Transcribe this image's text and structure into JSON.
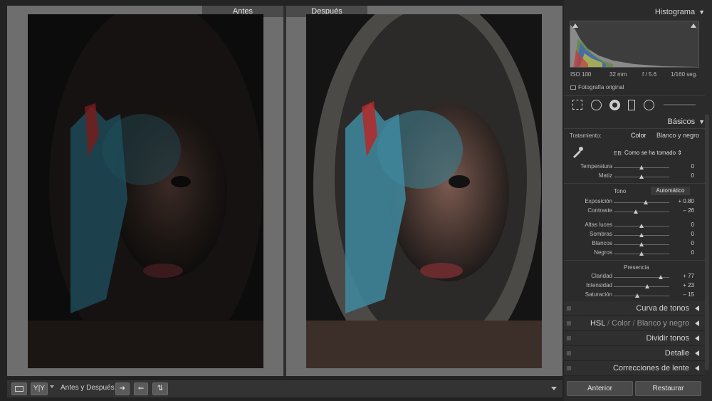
{
  "compare": {
    "before_label": "Antes",
    "after_label": "Después"
  },
  "toolbar": {
    "label": "Antes y Después:",
    "yy": "Y|Y"
  },
  "histogram": {
    "title": "Histograma",
    "iso": "ISO 100",
    "focal": "32 mm",
    "aperture": "f / 5.6",
    "shutter": "1/160 seg.",
    "original": "Fotografía original"
  },
  "basics": {
    "title": "Básicos",
    "treatment_label": "Tratamiento:",
    "color": "Color",
    "bw": "Blanco y negro",
    "wb_label": "EB:",
    "wb_value": "Como se ha tomado",
    "tone_label": "Tono",
    "auto": "Automático",
    "presence_label": "Presencia",
    "rows_wb": [
      {
        "name": "Temperatura",
        "value": "0",
        "pos": 0.5
      },
      {
        "name": "Matiz",
        "value": "0",
        "pos": 0.5
      }
    ],
    "rows_tone1": [
      {
        "name": "Exposición",
        "value": "+ 0.80",
        "pos": 0.58
      },
      {
        "name": "Contraste",
        "value": "– 26",
        "pos": 0.4
      }
    ],
    "rows_tone2": [
      {
        "name": "Altas luces",
        "value": "0",
        "pos": 0.5
      },
      {
        "name": "Sombras",
        "value": "0",
        "pos": 0.5
      },
      {
        "name": "Blancos",
        "value": "0",
        "pos": 0.5
      },
      {
        "name": "Negros",
        "value": "0",
        "pos": 0.5
      }
    ],
    "rows_presence": [
      {
        "name": "Claridad",
        "value": "+ 77",
        "pos": 0.85
      },
      {
        "name": "Intensidad",
        "value": "+ 23",
        "pos": 0.6
      },
      {
        "name": "Saturación",
        "value": "– 15",
        "pos": 0.42
      }
    ]
  },
  "panels": {
    "tone_curve": "Curva de tonos",
    "hsl": "HSL",
    "hsl_color": "Color",
    "hsl_bw": "Blanco y negro",
    "split": "Dividir tonos",
    "detail": "Detalle",
    "lens": "Correcciones de lente"
  },
  "buttons": {
    "previous": "Anterior",
    "reset": "Restaurar"
  }
}
